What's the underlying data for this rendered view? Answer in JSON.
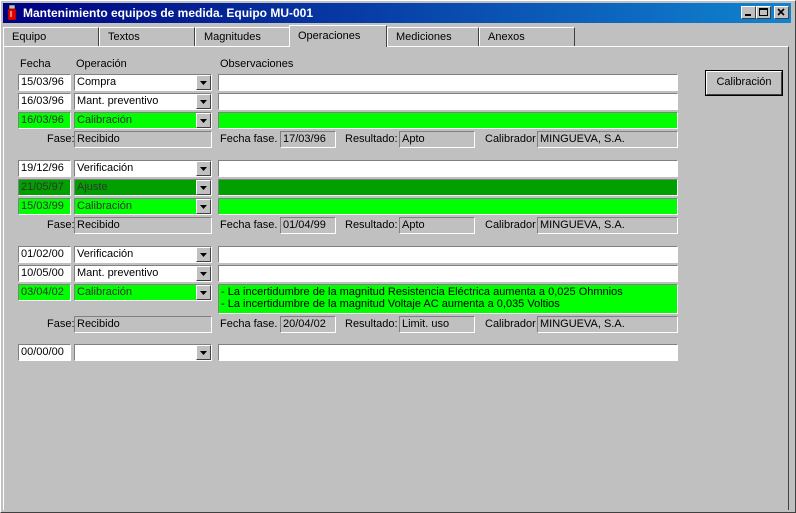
{
  "window": {
    "title": "Mantenimiento equipos de medida. Equipo MU-001"
  },
  "tabs": [
    "Equipo",
    "Textos",
    "Magnitudes",
    "Operaciones",
    "Mediciones",
    "Anexos"
  ],
  "active_tab": "Operaciones",
  "headers": {
    "fecha": "Fecha",
    "operacion": "Operación",
    "observaciones": "Observaciones"
  },
  "labels": {
    "fase": "Fase:",
    "fecha_fase": "Fecha fase.",
    "resultado": "Resultado:",
    "calibrador": "Calibrador"
  },
  "calibracion_button": "Calibración",
  "rows": [
    {
      "fecha": "15/03/96",
      "operacion": "Compra",
      "obs": ""
    },
    {
      "fecha": "16/03/96",
      "operacion": "Mant. preventivo",
      "obs": ""
    },
    {
      "fecha": "16/03/96",
      "operacion": "Calibración",
      "obs": ""
    },
    {
      "fecha": "19/12/96",
      "operacion": "Verificación",
      "obs": ""
    },
    {
      "fecha": "21/05/97",
      "operacion": "Ajuste",
      "obs": ""
    },
    {
      "fecha": "15/03/99",
      "operacion": "Calibración",
      "obs": ""
    },
    {
      "fecha": "01/02/00",
      "operacion": "Verificación",
      "obs": ""
    },
    {
      "fecha": "10/05/00",
      "operacion": "Mant. preventivo",
      "obs": ""
    },
    {
      "fecha": "03/04/02",
      "operacion": "Calibración",
      "obs1": "- La incertidumbre de la magnitud Resistencia Eléctrica aumenta a 0,025 Ohmnios",
      "obs2": "- La incertidumbre de la magnitud Voltaje AC aumenta a 0,035 Voltios"
    },
    {
      "fecha": "00/00/00",
      "operacion": "",
      "obs": ""
    }
  ],
  "fases": [
    {
      "fase": "Recibido",
      "fecha_fase": "17/03/96",
      "resultado": "Apto",
      "calibrador": "MINGUEVA, S.A."
    },
    {
      "fase": "Recibido",
      "fecha_fase": "01/04/99",
      "resultado": "Apto",
      "calibrador": "MINGUEVA, S.A."
    },
    {
      "fase": "Recibido",
      "fecha_fase": "20/04/02",
      "resultado": "Limit. uso",
      "calibrador": "MINGUEVA, S.A."
    }
  ],
  "colors": {
    "selected": "#00ff00",
    "selected_dark": "#00a000",
    "titlebar": "#000080"
  }
}
